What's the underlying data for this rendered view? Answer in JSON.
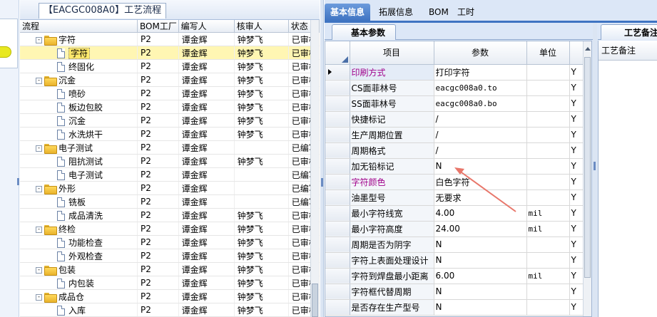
{
  "process_panel": {
    "title": "【EACGC008A0】工艺流程",
    "columns": [
      "流程",
      "BOM工厂",
      "编写人",
      "核审人",
      "状态"
    ],
    "rows": [
      {
        "level": 1,
        "type": "folder",
        "expander": "-",
        "name": "字符",
        "bom": "P2",
        "writer": "谭金辉",
        "reviewer": "钟梦飞",
        "status": "已审核"
      },
      {
        "level": 2,
        "type": "doc",
        "name": "字符",
        "bom": "P2",
        "writer": "谭金辉",
        "reviewer": "钟梦飞",
        "status": "已审核",
        "selected": true
      },
      {
        "level": 2,
        "type": "doc",
        "name": "终固化",
        "bom": "P2",
        "writer": "谭金辉",
        "reviewer": "钟梦飞",
        "status": "已审核"
      },
      {
        "level": 1,
        "type": "folder",
        "expander": "-",
        "name": "沉金",
        "bom": "P2",
        "writer": "谭金辉",
        "reviewer": "钟梦飞",
        "status": "已审核"
      },
      {
        "level": 2,
        "type": "doc",
        "name": "喷砂",
        "bom": "P2",
        "writer": "谭金辉",
        "reviewer": "钟梦飞",
        "status": "已审核"
      },
      {
        "level": 2,
        "type": "doc",
        "name": "板边包胶",
        "bom": "P2",
        "writer": "谭金辉",
        "reviewer": "钟梦飞",
        "status": "已审核"
      },
      {
        "level": 2,
        "type": "doc",
        "name": "沉金",
        "bom": "P2",
        "writer": "谭金辉",
        "reviewer": "钟梦飞",
        "status": "已审核"
      },
      {
        "level": 2,
        "type": "doc",
        "name": "水洗烘干",
        "bom": "P2",
        "writer": "谭金辉",
        "reviewer": "钟梦飞",
        "status": "已审核"
      },
      {
        "level": 1,
        "type": "folder",
        "expander": "-",
        "name": "电子测试",
        "bom": "P2",
        "writer": "谭金辉",
        "reviewer": "",
        "status": "已编写"
      },
      {
        "level": 2,
        "type": "doc",
        "name": "阻抗测试",
        "bom": "P2",
        "writer": "谭金辉",
        "reviewer": "钟梦飞",
        "status": "已审核"
      },
      {
        "level": 2,
        "type": "doc",
        "name": "电子测试",
        "bom": "P2",
        "writer": "谭金辉",
        "reviewer": "",
        "status": "已编写"
      },
      {
        "level": 1,
        "type": "folder",
        "expander": "-",
        "name": "外形",
        "bom": "P2",
        "writer": "谭金辉",
        "reviewer": "",
        "status": "已编写"
      },
      {
        "level": 2,
        "type": "doc",
        "name": "铣板",
        "bom": "P2",
        "writer": "谭金辉",
        "reviewer": "",
        "status": "已编写"
      },
      {
        "level": 2,
        "type": "doc",
        "name": "成品清洗",
        "bom": "P2",
        "writer": "谭金辉",
        "reviewer": "钟梦飞",
        "status": "已审核"
      },
      {
        "level": 1,
        "type": "folder",
        "expander": "-",
        "name": "终检",
        "bom": "P2",
        "writer": "谭金辉",
        "reviewer": "钟梦飞",
        "status": "已审核"
      },
      {
        "level": 2,
        "type": "doc",
        "name": "功能检查",
        "bom": "P2",
        "writer": "谭金辉",
        "reviewer": "钟梦飞",
        "status": "已审核"
      },
      {
        "level": 2,
        "type": "doc",
        "name": "外观检查",
        "bom": "P2",
        "writer": "谭金辉",
        "reviewer": "钟梦飞",
        "status": "已审核"
      },
      {
        "level": 1,
        "type": "folder",
        "expander": "-",
        "name": "包装",
        "bom": "P2",
        "writer": "谭金辉",
        "reviewer": "钟梦飞",
        "status": "已审核"
      },
      {
        "level": 2,
        "type": "doc",
        "name": "内包装",
        "bom": "P2",
        "writer": "谭金辉",
        "reviewer": "钟梦飞",
        "status": "已审核"
      },
      {
        "level": 1,
        "type": "folder",
        "expander": "-",
        "name": "成品仓",
        "bom": "P2",
        "writer": "谭金辉",
        "reviewer": "钟梦飞",
        "status": "已审核"
      },
      {
        "level": 2,
        "type": "doc",
        "name": "入库",
        "bom": "P2",
        "writer": "谭金辉",
        "reviewer": "钟梦飞",
        "status": "已审核"
      }
    ]
  },
  "main_tabs": [
    {
      "label": "基本信息",
      "active": true
    },
    {
      "label": "拓展信息",
      "active": false
    },
    {
      "label": "BOM",
      "active": false
    },
    {
      "label": "工时",
      "active": false
    }
  ],
  "param_panel": {
    "tab_label": "基本参数",
    "columns": [
      "项目",
      "参数",
      "单位"
    ],
    "rows": [
      {
        "item": "印刷方式",
        "value": "打印字符",
        "unit": "",
        "flag": "Y",
        "highlight": true,
        "current": true
      },
      {
        "item": "CS面菲林号",
        "value": "eacgc008a0.to",
        "unit": "",
        "flag": "Y",
        "mono": true
      },
      {
        "item": "SS面菲林号",
        "value": "eacgc008a0.bo",
        "unit": "",
        "flag": "Y",
        "mono": true
      },
      {
        "item": "快捷标记",
        "value": "/",
        "unit": "",
        "flag": "Y"
      },
      {
        "item": "生产周期位置",
        "value": "/",
        "unit": "",
        "flag": "Y"
      },
      {
        "item": "周期格式",
        "value": "/",
        "unit": "",
        "flag": "Y"
      },
      {
        "item": "加无铅标记",
        "value": "N",
        "unit": "",
        "flag": "Y"
      },
      {
        "item": "字符颜色",
        "value": "白色字符",
        "unit": "",
        "flag": "Y",
        "highlight": true
      },
      {
        "item": "油墨型号",
        "value": "无要求",
        "unit": "",
        "flag": "Y"
      },
      {
        "item": "最小字符线宽",
        "value": "4.00",
        "unit": "mil",
        "flag": "Y"
      },
      {
        "item": "最小字符高度",
        "value": "24.00",
        "unit": "mil",
        "flag": "Y"
      },
      {
        "item": "周期是否为阴字",
        "value": "N",
        "unit": "",
        "flag": "Y"
      },
      {
        "item": "字符上表面处理设计",
        "value": "N",
        "unit": "",
        "flag": "Y"
      },
      {
        "item": "字符到焊盘最小距离",
        "value": "6.00",
        "unit": "mil",
        "flag": "Y"
      },
      {
        "item": "字符框代替周期",
        "value": "N",
        "unit": "",
        "flag": "Y"
      },
      {
        "item": "是否存在生产型号",
        "value": "N",
        "unit": "",
        "flag": "Y"
      }
    ]
  },
  "remark_panel": {
    "tab_label": "工艺备注",
    "header": "工艺备注"
  },
  "colors": {
    "accent": "#3f74c2",
    "selected_row": "#fff6b3",
    "highlight_text": "#a0008a",
    "annotation_arrow": "#e8766a"
  }
}
